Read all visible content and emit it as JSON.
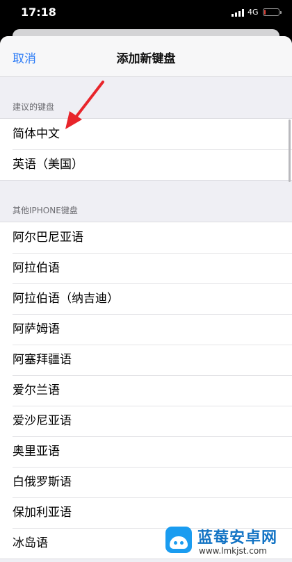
{
  "status_bar": {
    "time": "17:18",
    "network": "4G",
    "icons": [
      "signal-icon",
      "battery-icon"
    ],
    "battery_color": "#e0443a"
  },
  "nav": {
    "cancel_label": "取消",
    "title": "添加新键盘",
    "accent_color": "#2d7cf6"
  },
  "suggested": {
    "header": "建议的键盘",
    "items": [
      "简体中文",
      "英语（美国）"
    ]
  },
  "other": {
    "header": "其他IPHONE键盘",
    "items": [
      "阿尔巴尼亚语",
      "阿拉伯语",
      "阿拉伯语（纳吉迪）",
      "阿萨姆语",
      "阿塞拜疆语",
      "爱尔兰语",
      "爱沙尼亚语",
      "奥里亚语",
      "白俄罗斯语",
      "保加利亚语",
      "冰岛语"
    ]
  },
  "watermark": {
    "title": "蓝莓安卓网",
    "url": "www.lmkjst.com"
  }
}
